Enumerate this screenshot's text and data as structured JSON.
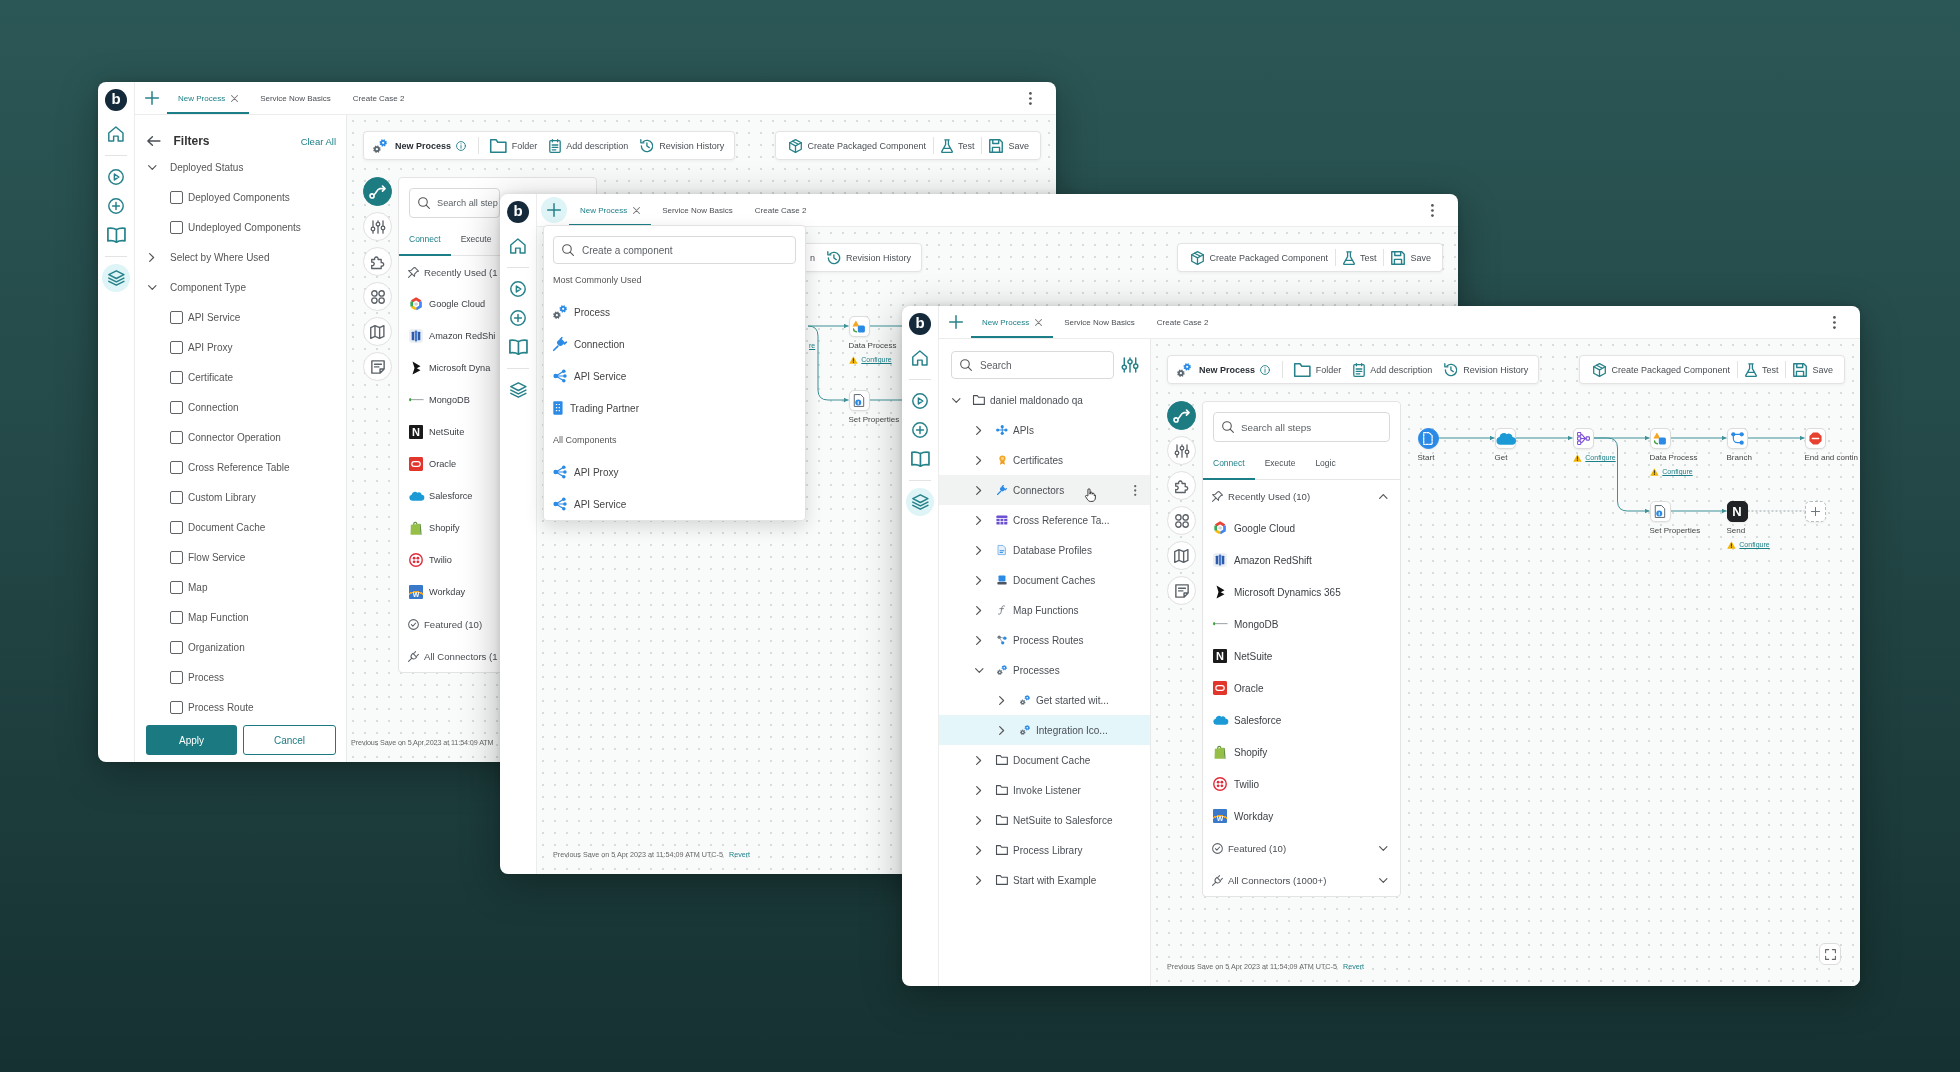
{
  "windows": [
    {
      "kind": "filters",
      "logo": "b",
      "add_active": false,
      "tabs": [
        {
          "label": "New Process",
          "selected": true
        },
        {
          "label": "Service Now Basics",
          "selected": false
        },
        {
          "label": "Create Case 2",
          "selected": false
        }
      ],
      "rail": [
        {
          "kind": "home",
          "selected": false
        },
        {
          "kind": "run",
          "selected": false
        },
        {
          "kind": "create",
          "selected": false
        },
        {
          "kind": "docs",
          "selected": false
        },
        {
          "kind": "components",
          "selected": true
        }
      ],
      "filters": {
        "title": "Filters",
        "clear": "Clear All",
        "groups": [
          {
            "label": "Deployed Status",
            "expanded": true,
            "options": [
              {
                "label": "Deployed Components",
                "checked": false
              },
              {
                "label": "Undeployed Components",
                "checked": false
              }
            ]
          },
          {
            "label": "Select by Where Used",
            "expanded": false
          },
          {
            "label": "Component Type",
            "expanded": true,
            "options": [
              {
                "label": "API Service",
                "checked": false
              },
              {
                "label": "API Proxy",
                "checked": false
              },
              {
                "label": "Certificate",
                "checked": false
              },
              {
                "label": "Connection",
                "checked": false
              },
              {
                "label": "Connector Operation",
                "checked": false
              },
              {
                "label": "Cross Reference Table",
                "checked": false
              },
              {
                "label": "Custom Library",
                "checked": false
              },
              {
                "label": "Document Cache",
                "checked": false
              },
              {
                "label": "Flow Service",
                "checked": false
              },
              {
                "label": "Map",
                "checked": false
              },
              {
                "label": "Map Function",
                "checked": false
              },
              {
                "label": "Organization",
                "checked": false
              },
              {
                "label": "Process",
                "checked": false
              },
              {
                "label": "Process Route",
                "checked": false
              }
            ]
          }
        ],
        "apply": "Apply",
        "cancel": "Cancel"
      },
      "toolbar": {
        "left": [
          {
            "kind": "process",
            "label": "New Process"
          },
          {
            "kind": "folder",
            "label": "Folder"
          },
          {
            "kind": "description",
            "label": "Add description"
          },
          {
            "kind": "history",
            "label": "Revision History"
          }
        ],
        "right": [
          {
            "kind": "package",
            "label": "Create Packaged Component"
          },
          {
            "kind": "test",
            "label": "Test"
          },
          {
            "kind": "save",
            "label": "Save"
          }
        ]
      },
      "tools": [
        {
          "kind": "flow",
          "selected": true
        },
        {
          "kind": "settings",
          "selected": false
        },
        {
          "kind": "extensions",
          "selected": false
        },
        {
          "kind": "apps",
          "selected": false
        },
        {
          "kind": "map",
          "selected": false
        },
        {
          "kind": "notes",
          "selected": false
        }
      ],
      "steps": {
        "search": {
          "placeholder": "Search all step"
        },
        "tabs": [
          {
            "label": "Connect",
            "selected": true
          },
          {
            "label": "Execute",
            "selected": false
          }
        ],
        "sections": [
          {
            "kind": "recent",
            "label": "Recently Used (1",
            "items": [
              {
                "kind": "google",
                "label": "Google Cloud"
              },
              {
                "kind": "redshift",
                "label": "Amazon RedShi"
              },
              {
                "kind": "dynamics",
                "label": "Microsoft Dyna"
              },
              {
                "kind": "mongodb",
                "label": "MongoDB"
              },
              {
                "kind": "netsuite",
                "label": "NetSuite",
                "letter": "N"
              },
              {
                "kind": "oracle",
                "label": "Oracle"
              },
              {
                "kind": "salesforce",
                "label": "Salesforce"
              },
              {
                "kind": "shopify",
                "label": "Shopify"
              },
              {
                "kind": "twilio",
                "label": "Twilio"
              },
              {
                "kind": "workday",
                "label": "Workday",
                "letter": "W"
              }
            ]
          },
          {
            "kind": "featured",
            "label": "Featured (10)"
          },
          {
            "kind": "all",
            "label": "All Connectors (1"
          }
        ]
      },
      "footer": {
        "text": "Previous Save on 5 Apr 2023 at 11:54:09 ATM"
      }
    },
    {
      "kind": "menu",
      "logo": "b",
      "add_active": true,
      "tabs": [
        {
          "label": "New Process",
          "selected": true
        },
        {
          "label": "Service Now Basics",
          "selected": false
        },
        {
          "label": "Create Case 2",
          "selected": false
        }
      ],
      "rail": [
        {
          "kind": "home",
          "selected": false
        },
        {
          "kind": "run",
          "selected": false
        },
        {
          "kind": "create",
          "selected": false
        },
        {
          "kind": "docs",
          "selected": false
        },
        {
          "kind": "components",
          "selected": false
        }
      ],
      "toolbar": {
        "left": [
          {
            "kind": "cut",
            "label": "n"
          },
          {
            "kind": "history",
            "label": "Revision History"
          }
        ],
        "right": [
          {
            "kind": "package",
            "label": "Create Packaged Component"
          },
          {
            "kind": "test",
            "label": "Test"
          },
          {
            "kind": "save",
            "label": "Save"
          }
        ]
      },
      "flow": {
        "nodes": [
          {
            "kind": "data",
            "label": "Data Process",
            "configure": "Configure"
          },
          {
            "kind": "properties",
            "label": "Set Properties"
          }
        ],
        "cut_links": [
          "re"
        ]
      },
      "footer": {
        "text": "Previous Save on 5 Apr 2023 at 11:54:09 ATM UTC-5",
        "link": "Revert"
      },
      "create_menu": {
        "search": {
          "placeholder": "Create a component"
        },
        "sections": [
          {
            "title": "Most Commonly Used",
            "items": [
              {
                "kind": "process",
                "label": "Process"
              },
              {
                "kind": "connection",
                "label": "Connection"
              },
              {
                "kind": "api",
                "label": "API Service"
              },
              {
                "kind": "partner",
                "label": "Trading Partner"
              }
            ]
          },
          {
            "title": "All Components",
            "items": [
              {
                "kind": "api",
                "label": "API Proxy"
              },
              {
                "kind": "api",
                "label": "API Service"
              }
            ]
          }
        ]
      }
    },
    {
      "kind": "tree",
      "logo": "b",
      "add_active": false,
      "tabs": [
        {
          "label": "New Process",
          "selected": true
        },
        {
          "label": "Service Now Basics",
          "selected": false
        },
        {
          "label": "Create Case 2",
          "selected": false
        }
      ],
      "rail": [
        {
          "kind": "home",
          "selected": false
        },
        {
          "kind": "run",
          "selected": false
        },
        {
          "kind": "create",
          "selected": false
        },
        {
          "kind": "docs",
          "selected": false
        },
        {
          "kind": "components",
          "selected": true
        }
      ],
      "tree": {
        "search": {
          "placeholder": "Search"
        },
        "nodes": [
          {
            "kind": "folder",
            "label": "daniel maldonado qa",
            "expanded": true,
            "selected": false,
            "hovered": false,
            "children": [
              {
                "kind": "api",
                "label": "APIs",
                "expanded": false,
                "selected": false,
                "hovered": false
              },
              {
                "kind": "certificate",
                "label": "Certificates",
                "expanded": false,
                "selected": false,
                "hovered": false
              },
              {
                "kind": "connector",
                "label": "Connectors",
                "expanded": false,
                "selected": false,
                "hovered": true
              },
              {
                "kind": "table",
                "label": "Cross Reference Ta...",
                "expanded": false,
                "selected": false,
                "hovered": false
              },
              {
                "kind": "database",
                "label": "Database Profiles",
                "expanded": false,
                "selected": false,
                "hovered": false
              },
              {
                "kind": "cache",
                "label": "Document Caches",
                "expanded": false,
                "selected": false,
                "hovered": false
              },
              {
                "kind": "function",
                "label": "Map Functions",
                "expanded": false,
                "selected": false,
                "hovered": false
              },
              {
                "kind": "routes",
                "label": "Process Routes",
                "expanded": false,
                "selected": false,
                "hovered": false
              },
              {
                "kind": "process",
                "label": "Processes",
                "expanded": true,
                "selected": false,
                "hovered": false,
                "children": [
                  {
                    "kind": "process",
                    "label": "Get started wit...",
                    "expanded": false,
                    "selected": false,
                    "hovered": false
                  },
                  {
                    "kind": "process",
                    "label": "Integration Ico...",
                    "expanded": false,
                    "selected": true,
                    "hovered": false
                  }
                ]
              },
              {
                "kind": "folder",
                "label": "Document Cache",
                "expanded": false,
                "selected": false,
                "hovered": false
              },
              {
                "kind": "folder",
                "label": "Invoke Listener",
                "expanded": false,
                "selected": false,
                "hovered": false
              },
              {
                "kind": "folder",
                "label": "NetSuite to Salesforce",
                "expanded": false,
                "selected": false,
                "hovered": false
              },
              {
                "kind": "folder",
                "label": "Process Library",
                "expanded": false,
                "selected": false,
                "hovered": false
              },
              {
                "kind": "folder",
                "label": "Start with Example",
                "expanded": false,
                "selected": false,
                "hovered": false
              }
            ]
          }
        ]
      },
      "toolbar": {
        "left": [
          {
            "kind": "process",
            "label": "New Process"
          },
          {
            "kind": "folder",
            "label": "Folder"
          },
          {
            "kind": "description",
            "label": "Add description"
          },
          {
            "kind": "history",
            "label": "Revision History"
          }
        ],
        "right": [
          {
            "kind": "package",
            "label": "Create Packaged Component"
          },
          {
            "kind": "test",
            "label": "Test"
          },
          {
            "kind": "save",
            "label": "Save"
          }
        ]
      },
      "tools": [
        {
          "kind": "flow",
          "selected": true
        },
        {
          "kind": "settings",
          "selected": false
        },
        {
          "kind": "extensions",
          "selected": false
        },
        {
          "kind": "apps",
          "selected": false
        },
        {
          "kind": "map",
          "selected": false
        },
        {
          "kind": "notes",
          "selected": false
        }
      ],
      "steps": {
        "search": {
          "placeholder": "Search all steps"
        },
        "tabs": [
          {
            "label": "Connect",
            "selected": true
          },
          {
            "label": "Execute",
            "selected": false
          },
          {
            "label": "Logic",
            "selected": false
          }
        ],
        "sections": [
          {
            "kind": "recent",
            "label": "Recently Used (10)",
            "expanded": true,
            "items": [
              {
                "kind": "google",
                "label": "Google Cloud"
              },
              {
                "kind": "redshift",
                "label": "Amazon RedShift"
              },
              {
                "kind": "dynamics",
                "label": "Microsoft Dynamics 365"
              },
              {
                "kind": "mongodb",
                "label": "MongoDB"
              },
              {
                "kind": "netsuite",
                "label": "NetSuite",
                "letter": "N"
              },
              {
                "kind": "oracle",
                "label": "Oracle"
              },
              {
                "kind": "salesforce",
                "label": "Salesforce"
              },
              {
                "kind": "shopify",
                "label": "Shopify"
              },
              {
                "kind": "twilio",
                "label": "Twilio"
              },
              {
                "kind": "workday",
                "label": "Workday",
                "letter": "W"
              }
            ]
          },
          {
            "kind": "featured",
            "label": "Featured (10)",
            "expanded": false
          },
          {
            "kind": "all",
            "label": "All Connectors (1000+)",
            "expanded": false
          }
        ]
      },
      "flow": {
        "nodes": [
          {
            "kind": "start",
            "label": "Start"
          },
          {
            "kind": "salesforce",
            "label": "Get"
          },
          {
            "kind": "map",
            "configure": "Configure"
          },
          {
            "kind": "data",
            "label": "Data Process",
            "configure": "Configure"
          },
          {
            "kind": "branch",
            "label": "Branch"
          },
          {
            "kind": "stop",
            "label": "End and contin"
          },
          {
            "kind": "properties",
            "label": "Set Properties"
          },
          {
            "kind": "netsuite",
            "label": "Send",
            "letter": "N",
            "configure": "Configure"
          },
          {
            "kind": "add"
          }
        ]
      },
      "footer": {
        "text": "Previous Save on 5 Apr 2023 at 11:54:09 ATM UTC-5",
        "link": "Revert"
      },
      "fullscreen": true
    }
  ]
}
